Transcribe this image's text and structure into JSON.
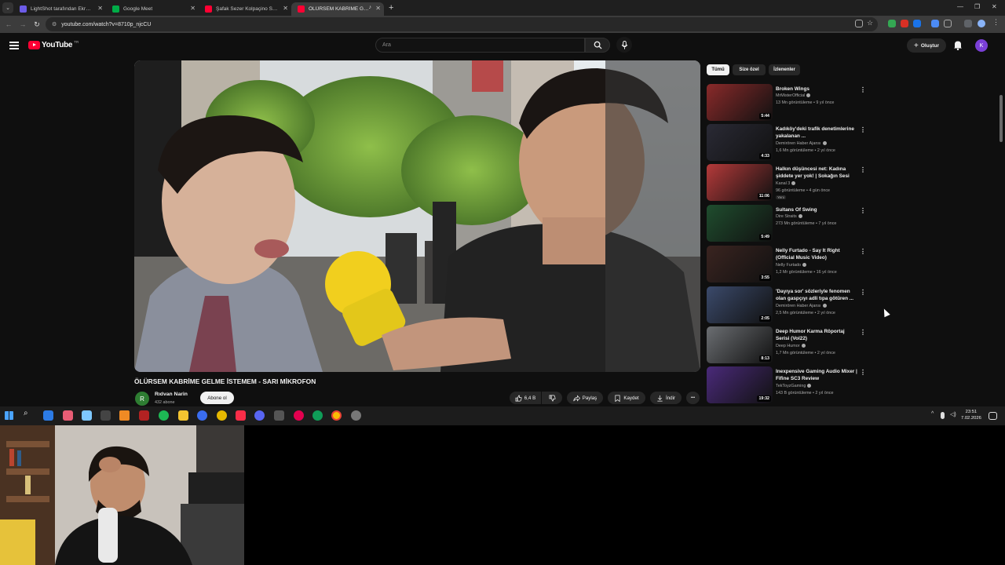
{
  "browser": {
    "tabs": [
      {
        "label": "LightShot tarafından Ekran Gör…",
        "color": "#6c5ce7",
        "active": false
      },
      {
        "label": "Google Meet",
        "color": "#00ac47",
        "active": false
      },
      {
        "label": "Şafak Sezer Kolpaçino Sahnele…",
        "color": "#ff0033",
        "active": false
      },
      {
        "label": "ÖLÜRSEM KABRİME GELME…",
        "color": "#ff0033",
        "active": true
      }
    ],
    "url": "youtube.com/watch?v=8710p_njcCU"
  },
  "youtube": {
    "logo_text": "YouTube",
    "logo_country": "TR",
    "search_placeholder": "Ara",
    "create_label": "Oluştur",
    "avatar_letter": "K"
  },
  "video": {
    "title": "ÖLÜRSEM KABRİME GELME İSTEMEM - SARI MİKROFON",
    "channel": "Rıdvan Narin",
    "channel_initial": "R",
    "subscribers": "432 abone",
    "subscribe_label": "Abone ol",
    "likes": "6,4 B",
    "share_label": "Paylaş",
    "save_label": "Kaydet",
    "download_label": "İndir",
    "more_label": "•••"
  },
  "chips": [
    {
      "label": "Tümü",
      "selected": true
    },
    {
      "label": "Size özel",
      "selected": false
    },
    {
      "label": "İzlenenler",
      "selected": false
    }
  ],
  "recommendations": [
    {
      "title": "Broken Wings",
      "channel": "MrMisterOfficial",
      "meta": "13 Mn görüntüleme • 9 yıl önce",
      "duration": "5:44",
      "badge": "",
      "thumb": "#8a2a2a"
    },
    {
      "title": "Kadıköy'deki trafik denetimlerine yakalanan ...",
      "channel": "Demirören Haber Ajansı",
      "meta": "1,6 Mn görüntüleme • 2 yıl önce",
      "duration": "4:33",
      "badge": "",
      "thumb": "#2a2a35"
    },
    {
      "title": "Halkın düşüncesi net: Kadına şiddete yer yok! | Sokağın Sesi",
      "channel": "Kanal 3",
      "meta": "96 görüntüleme • 4 gün önce",
      "duration": "11:06",
      "badge": "Yeni",
      "thumb": "#b53a3a"
    },
    {
      "title": "Sultans Of Swing",
      "channel": "Dire Straits",
      "meta": "273 Mn görüntüleme • 7 yıl önce",
      "duration": "5:49",
      "badge": "",
      "thumb": "#1f4d2e"
    },
    {
      "title": "Nelly Furtado - Say It Right (Official Music Video)",
      "channel": "Nelly Furtado",
      "meta": "1,2 Mr görüntüleme • 16 yıl önce",
      "duration": "3:55",
      "badge": "",
      "thumb": "#3a2420"
    },
    {
      "title": "'Dayıya sor' sözleriyle fenomen olan gaspçıyı adli tıpa götüren ...",
      "channel": "Demirören Haber Ajansı",
      "meta": "2,5 Mn görüntüleme • 2 yıl önce",
      "duration": "2:05",
      "badge": "",
      "thumb": "#3b4a6b"
    },
    {
      "title": "Deep Humor Karma Röportaj Serisi (Vol22)",
      "channel": "Deep Humor",
      "meta": "1,7 Mn görüntüleme • 2 yıl önce",
      "duration": "8:13",
      "badge": "",
      "thumb": "#6b6e72"
    },
    {
      "title": "Inexpensive Gaming Audio Mixer | Fifine SC3 Review",
      "channel": "TekToyzGaming",
      "meta": "143 B görüntüleme • 2 yıl önce",
      "duration": "19:32",
      "badge": "",
      "thumb": "#4a2a7a"
    }
  ],
  "taskbar": {
    "time": "23:51",
    "date": "7.02.2026"
  }
}
